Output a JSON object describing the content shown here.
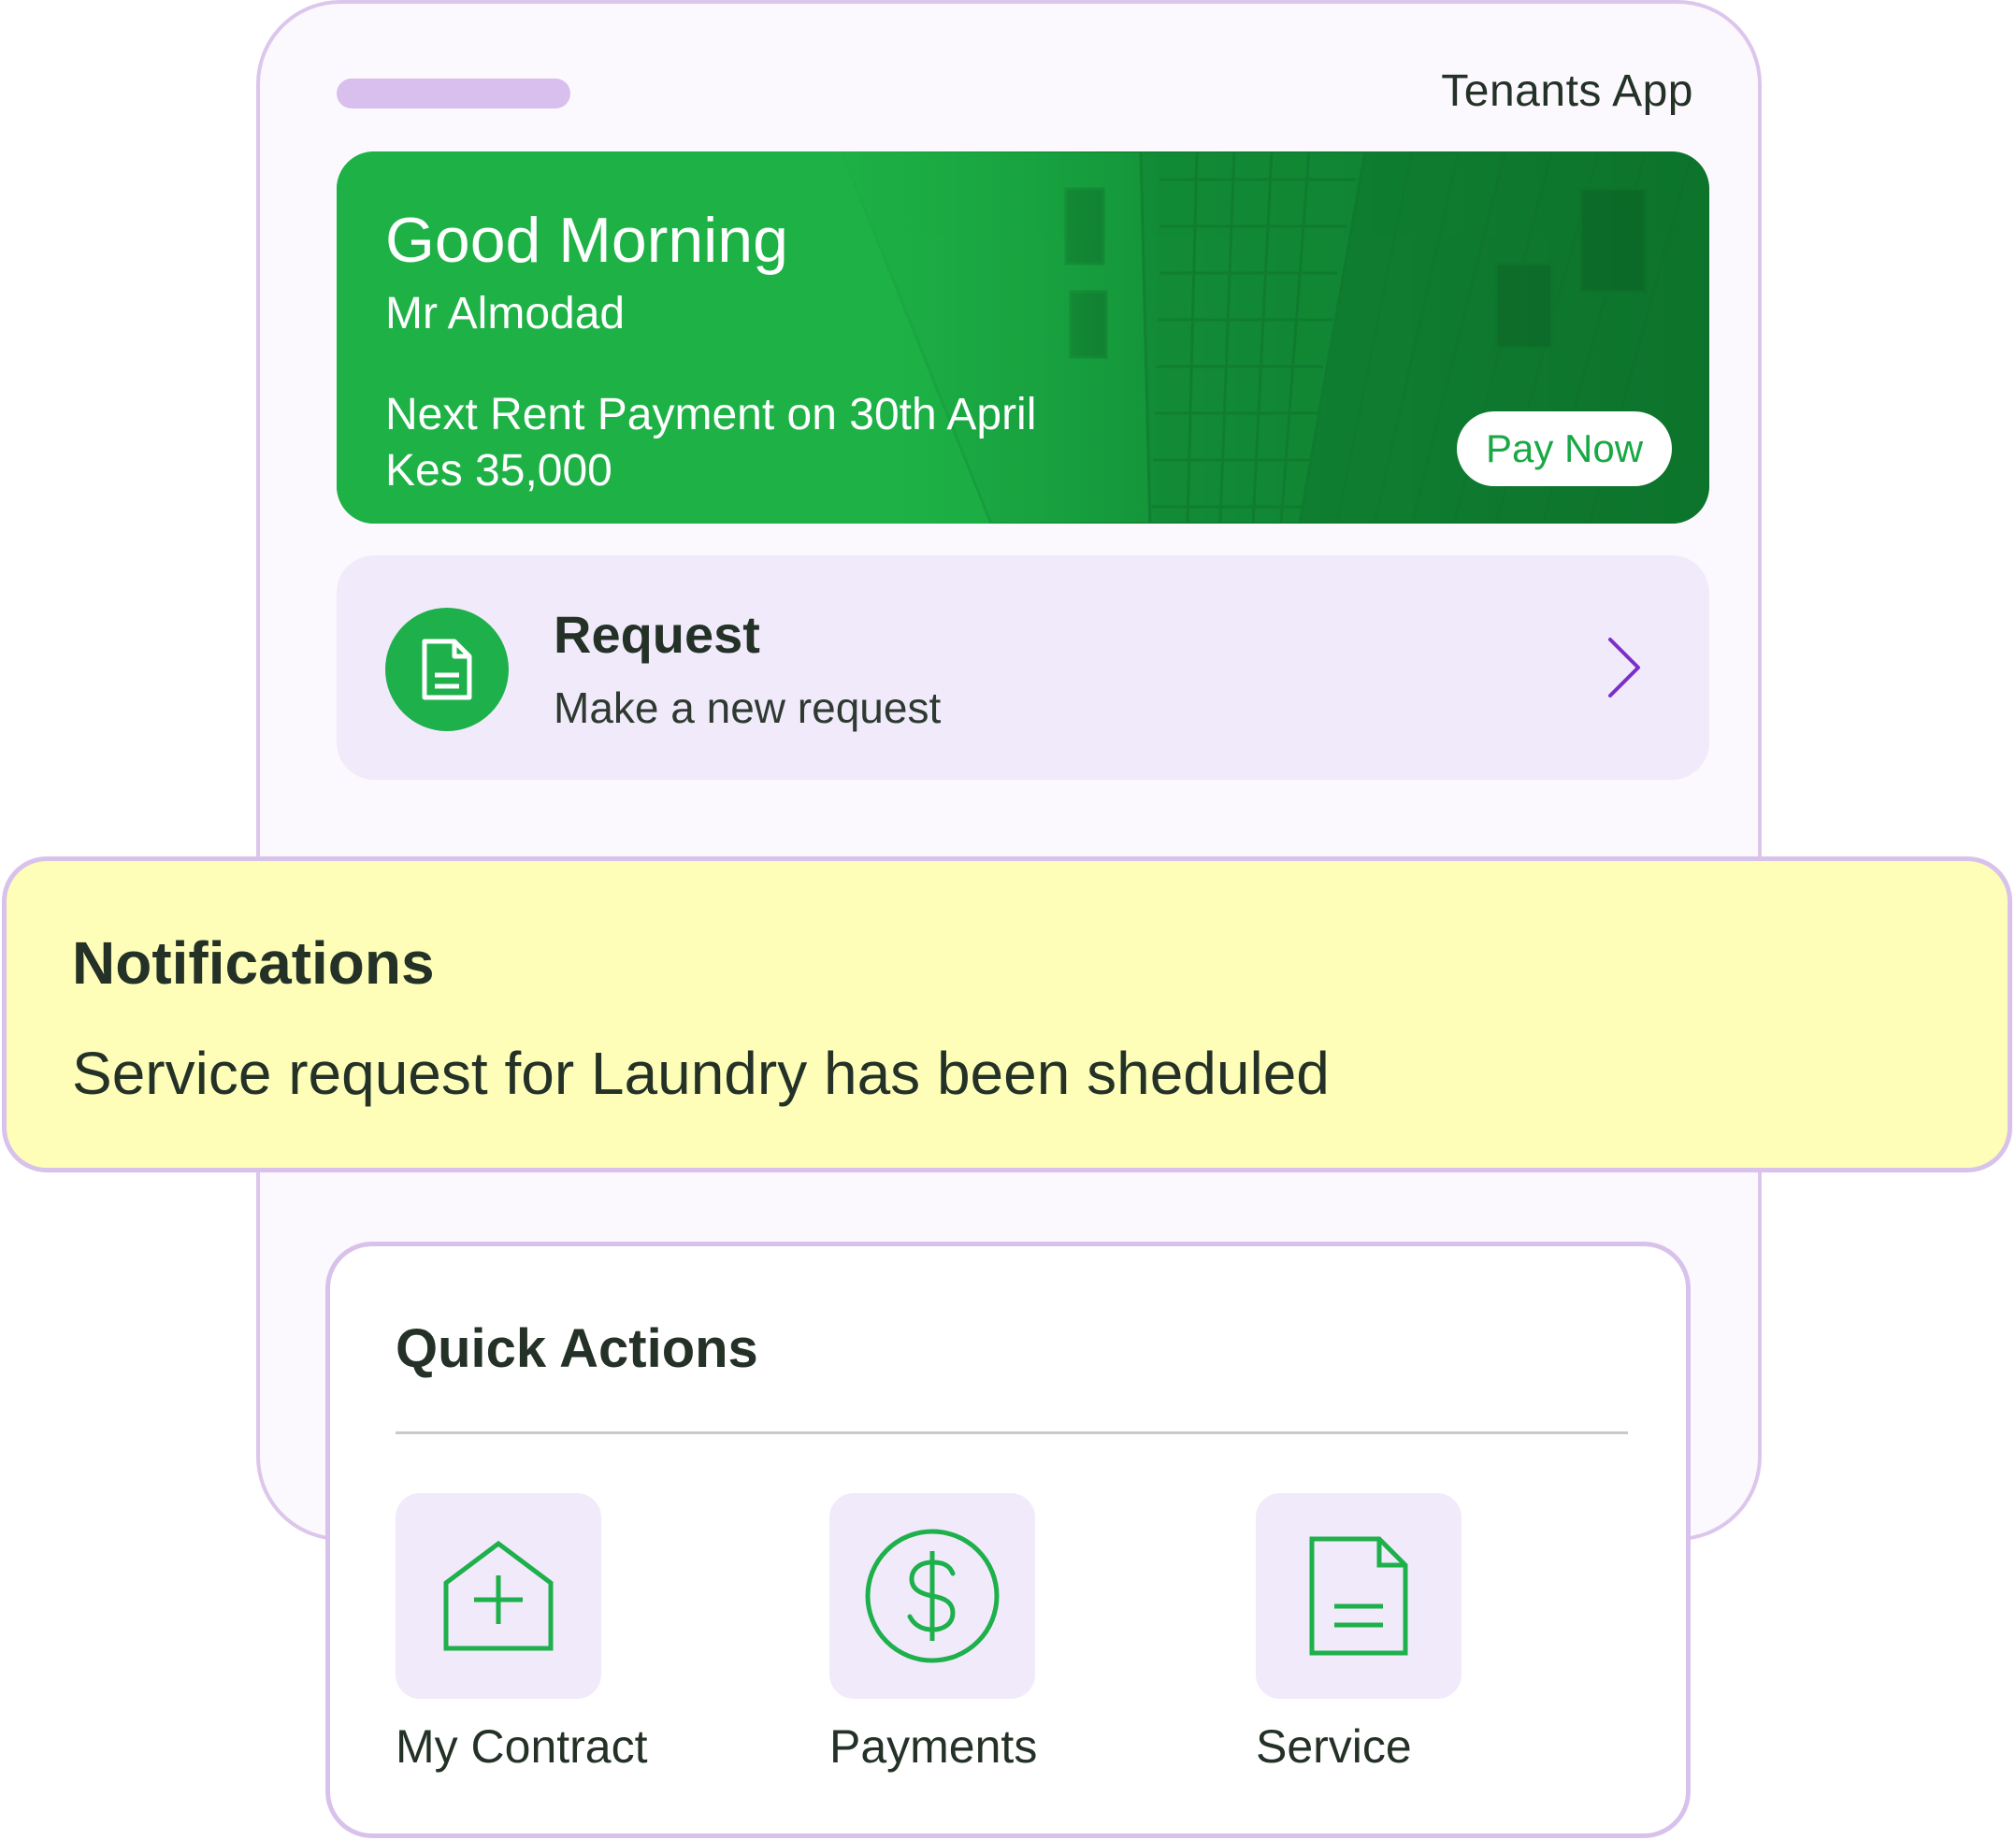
{
  "app": {
    "title": "Tenants App"
  },
  "banner": {
    "greeting": "Good Morning",
    "name": "Mr Almodad",
    "next_payment": "Next Rent Payment on 30th April",
    "amount": "Kes 35,000",
    "pay_button": "Pay Now"
  },
  "request": {
    "title": "Request",
    "subtitle": "Make a new request",
    "icon": "document-icon"
  },
  "notification": {
    "title": "Notifications",
    "message": "Service request for Laundry has been sheduled"
  },
  "quick_actions": {
    "title": "Quick Actions",
    "items": [
      {
        "label": "My Contract",
        "icon": "house-plus-icon"
      },
      {
        "label": "Payments",
        "icon": "dollar-circle-icon"
      },
      {
        "label": "Service",
        "icon": "document-icon"
      }
    ]
  },
  "colors": {
    "accent_green": "#1eb04a",
    "accent_purple": "#7b2fc9",
    "border_lavender": "#d8c2ec",
    "notification_bg": "#fefeb8",
    "card_bg": "#f1eafb"
  }
}
